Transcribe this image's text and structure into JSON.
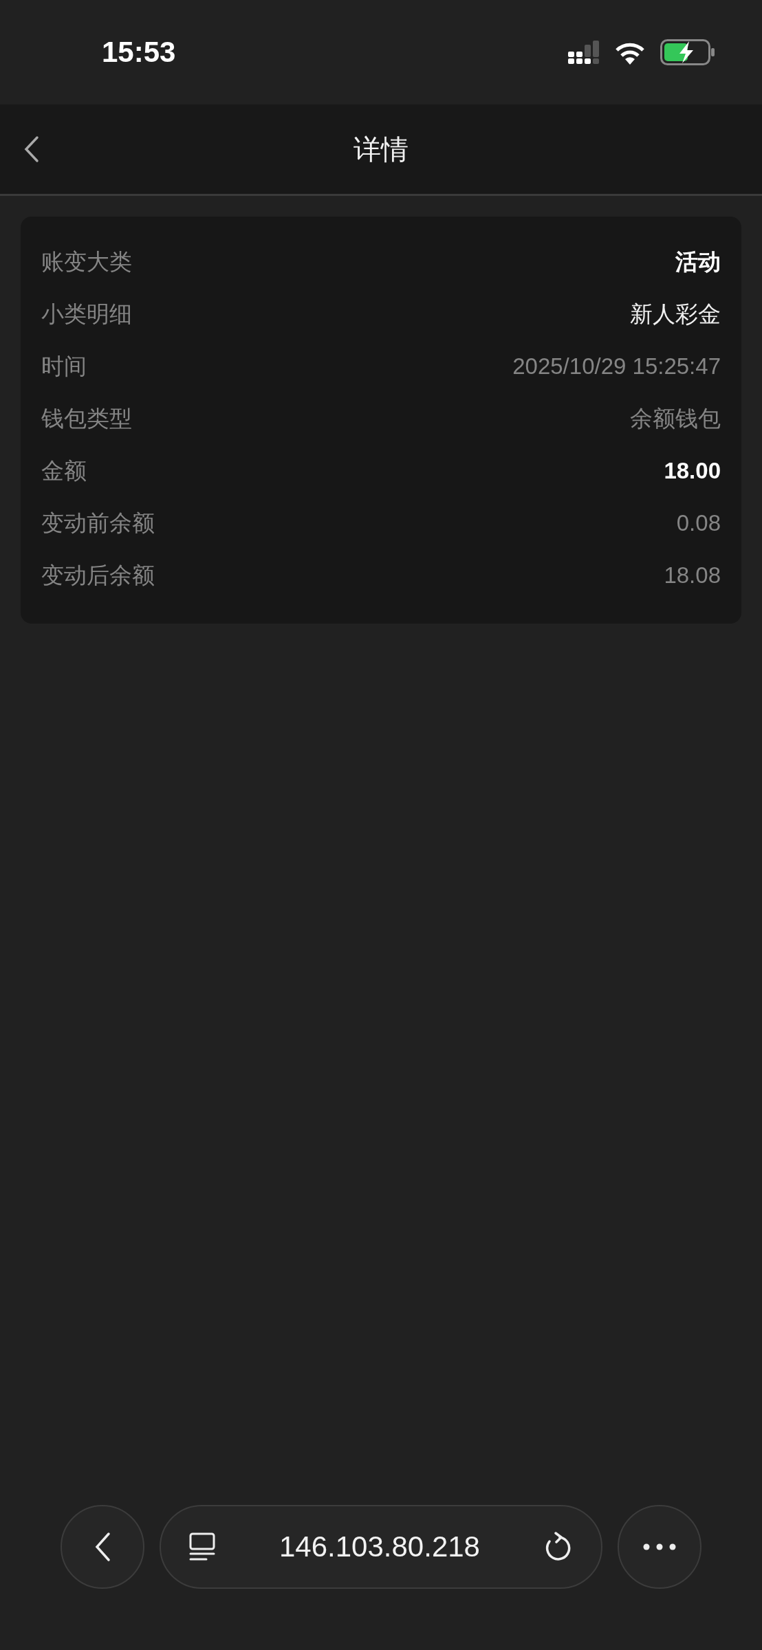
{
  "status_bar": {
    "time": "15:53"
  },
  "header": {
    "title": "详情"
  },
  "details": [
    {
      "label": "账变大类",
      "value": "活动",
      "kind": "strong"
    },
    {
      "label": "小类明细",
      "value": "新人彩金",
      "kind": "plain"
    },
    {
      "label": "时间",
      "value": "2025/10/29 15:25:47",
      "kind": "muted"
    },
    {
      "label": "钱包类型",
      "value": "余额钱包",
      "kind": "muted"
    },
    {
      "label": "金额",
      "value": "18.00",
      "kind": "strong"
    },
    {
      "label": "变动前余额",
      "value": "0.08",
      "kind": "muted"
    },
    {
      "label": "变动后余额",
      "value": "18.08",
      "kind": "muted"
    }
  ],
  "browser_bar": {
    "url": "146.103.80.218"
  }
}
